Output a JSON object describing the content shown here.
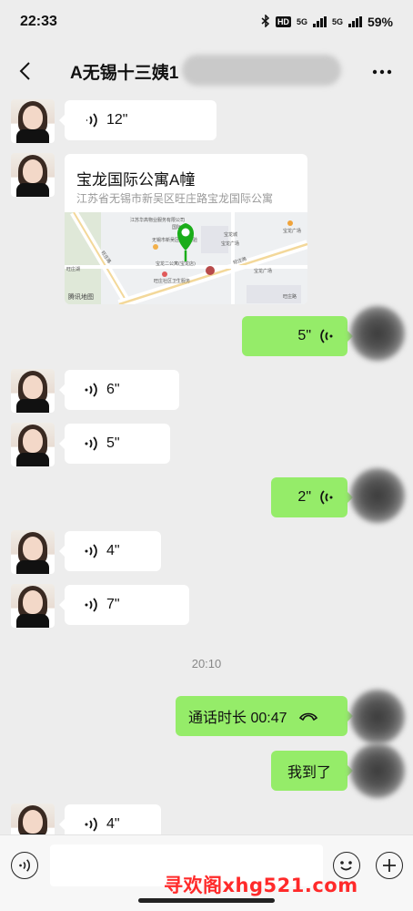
{
  "status": {
    "time": "22:33",
    "hd": "HD",
    "net": "5G",
    "battery": "59%"
  },
  "header": {
    "title": "A无锡十三姨1"
  },
  "messages": [
    {
      "side": "left",
      "type": "voice",
      "duration": "12\""
    },
    {
      "side": "left",
      "type": "location",
      "name": "宝龙国际公寓A幢",
      "address": "江苏省无锡市新吴区旺庄路宝龙国际公寓"
    },
    {
      "side": "right",
      "type": "voice",
      "duration": "5\""
    },
    {
      "side": "left",
      "type": "voice",
      "duration": "6\""
    },
    {
      "side": "left",
      "type": "voice",
      "duration": "5\""
    },
    {
      "side": "right",
      "type": "voice",
      "duration": "2\""
    },
    {
      "side": "left",
      "type": "voice",
      "duration": "4\""
    },
    {
      "side": "left",
      "type": "voice",
      "duration": "7\""
    },
    {
      "type": "time",
      "text": "20:10"
    },
    {
      "side": "right",
      "type": "call",
      "text": "通话时长 00:47"
    },
    {
      "side": "right",
      "type": "text",
      "text": "我到了"
    },
    {
      "side": "left",
      "type": "voice",
      "duration": "4\""
    }
  ],
  "map": {
    "labels": [
      "江苏华高物业服务有限公司",
      "国际",
      "无锡市新吴区旺庄实验",
      "宝龙城",
      "宝龙广场",
      "宝龙广场",
      "宝龙二公寓(宝龙店)",
      "旺庄路",
      "旺庄湖",
      "旺庄路",
      "宝龙广场",
      "旺庄社区卫生服务",
      "旺庄路",
      "腾讯地图"
    ],
    "credit": "腾讯地图"
  },
  "watermark": "寻欢阁xhg521.com",
  "colors": {
    "bubble_self": "#95ec69",
    "bubble_other": "#ffffff",
    "background": "#ededed",
    "pin": "#1aad19"
  }
}
